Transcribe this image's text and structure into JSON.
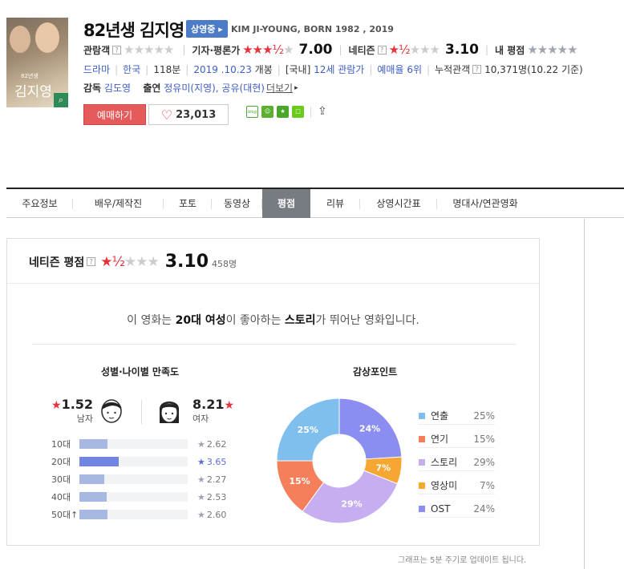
{
  "movie": {
    "title": "82년생 김지영",
    "status_badge": "상영중",
    "english_title": "KIM JI-YOUNG, BORN 1982 , 2019",
    "poster_text": "김지영",
    "poster_subtext": "82년생"
  },
  "ratings": {
    "audience_label": "관람객",
    "critic_label": "기자·평론가",
    "critic_score": "7.00",
    "netizen_label": "네티즌",
    "netizen_score": "3.10",
    "my_label": "내 평점"
  },
  "info": {
    "genre": "드라마",
    "country": "한국",
    "runtime": "118분",
    "release": "2019 .10.23",
    "release_suffix": "개봉",
    "rating_prefix": "[국내]",
    "rating": "12세 관람가",
    "rank": "예매율 6위",
    "cumulative_label": "누적관객",
    "cumulative": "10,371명(10.22 기준)"
  },
  "credits": {
    "director_label": "감독",
    "director": "김도영",
    "cast_label": "출연",
    "cast": "정유미(지영), 공유(대현)",
    "more": "더보기"
  },
  "actions": {
    "reserve": "예매하기",
    "likes": "23,013",
    "share_blog": "blog"
  },
  "tabs": [
    "주요정보",
    "배우/제작진",
    "포토",
    "동영상",
    "평점",
    "리뷰",
    "상영시간표",
    "명대사/연관영화"
  ],
  "panel": {
    "title": "네티즌 평점",
    "score": "3.10",
    "count": "458명",
    "summary_pre": "이 영화는 ",
    "summary_b1": "20대 여성",
    "summary_mid": "이 좋아하는 ",
    "summary_b2": "스토리",
    "summary_post": "가 뛰어난 영화입니다."
  },
  "demographics": {
    "title": "성별·나이별 만족도",
    "male_score": "1.52",
    "male_label": "남자",
    "female_score": "8.21",
    "female_label": "여자",
    "ages": [
      {
        "label": "10대",
        "score": "2.62",
        "value": 2.62
      },
      {
        "label": "20대",
        "score": "3.65",
        "value": 3.65
      },
      {
        "label": "30대",
        "score": "2.27",
        "value": 2.27
      },
      {
        "label": "40대",
        "score": "2.53",
        "value": 2.53
      },
      {
        "label": "50대↑",
        "score": "2.60",
        "value": 2.6
      }
    ]
  },
  "chart_data": {
    "type": "pie",
    "title": "감상포인트",
    "categories": [
      "연출",
      "연기",
      "스토리",
      "영상미",
      "OST"
    ],
    "values": [
      25,
      15,
      29,
      7,
      24
    ],
    "labels": [
      "25%",
      "15%",
      "29%",
      "7%",
      "24%"
    ],
    "colors": [
      "#7fbfee",
      "#f47f5a",
      "#c6aef0",
      "#f6a731",
      "#8b8df0"
    ],
    "donut": true,
    "legend_position": "right"
  },
  "footer": "그래프는 5분 주기로 업데이트 됩니다.",
  "icons": {
    "help": "?",
    "star": "★",
    "heart": "♡",
    "magnifier": "🔍",
    "share": "⇪"
  }
}
